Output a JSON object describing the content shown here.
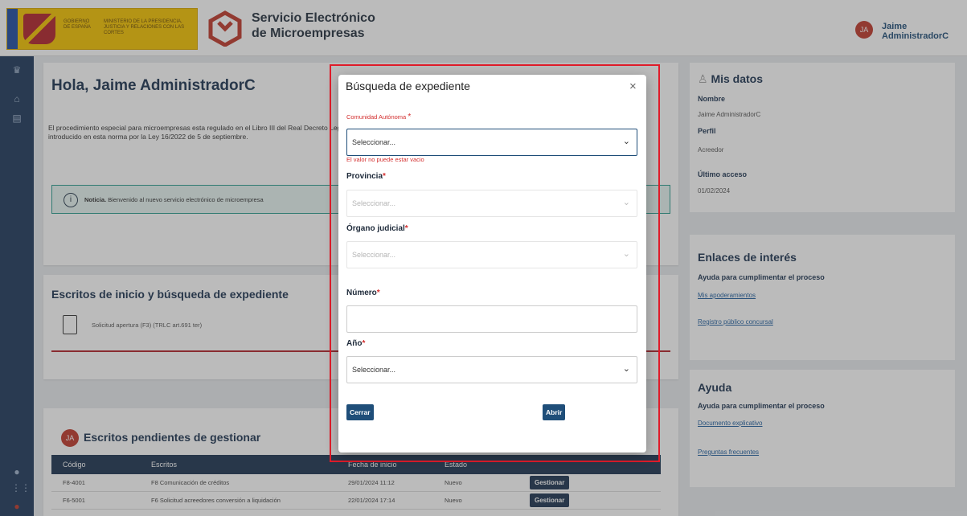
{
  "header": {
    "gov_line1": "GOBIERNO DE ESPAÑA",
    "gov_line2": "MINISTERIO DE LA PRESIDENCIA, JUSTICIA Y RELACIONES CON LAS CORTES",
    "app_title": "Servicio Electrónico de Microempresas",
    "user_initials": "JA",
    "user_name": "Jaime AdministradorC"
  },
  "main": {
    "greeting": "Hola, Jaime AdministradorC",
    "intro": "El procedimiento especial para microempresas esta regulado en el Libro III del Real Decreto Legislativo 1/2020, de 5 de mayo, por el que se aprueba el texto refundido de la Ley Concursal y ha sido introducido en esta norma por la Ley 16/2022 de 5 de septiembre.",
    "notice_label": "Noticia.",
    "notice_text": "Bienvenido al nuevo servicio electrónico de microempresa",
    "escritos_title": "Escritos de inicio y búsqueda de expediente",
    "escrito_item": "Solicitud apertura (F3) (TRLC art.691 ter)",
    "pendientes_title": "Escritos pendientes de gestionar",
    "table": {
      "headers": [
        "Código",
        "Escritos",
        "Fecha de inicio",
        "Estado"
      ],
      "rows": [
        [
          "F8-4001",
          "F8 Comunicación de créditos",
          "29/01/2024 11:12",
          "Nuevo",
          "Gestionar"
        ],
        [
          "F6-5001",
          "F6 Solicitud acreedores conversión a liquidación",
          "22/01/2024 17:14",
          "Nuevo",
          "Gestionar"
        ]
      ]
    }
  },
  "side": {
    "mis_datos": "Mis datos",
    "nombre_label": "Nombre",
    "nombre_val": "Jaime AdministradorC",
    "perfil_label": "Perfil",
    "perfil_val": "Acreedor",
    "acceso_label": "Último acceso",
    "acceso_val": "01/02/2024",
    "enlaces_title": "Enlaces de interés",
    "enlaces_sub": "Ayuda para cumplimentar el proceso",
    "link1": "Mis apoderamientos",
    "link2": "Registro público concursal",
    "ayuda_title": "Ayuda",
    "ayuda_sub": "Ayuda para cumplimentar el proceso",
    "link3": "Documento explicativo",
    "link4": "Preguntas frecuentes"
  },
  "modal": {
    "title": "Búsqueda de expediente",
    "close": "×",
    "comunidad_label": "Comunidad Autónoma",
    "comunidad_value": "Seleccionar...",
    "comunidad_error": "El valor no puede estar vacio",
    "provincia_label": "Provincia",
    "provincia_value": "Seleccionar...",
    "organo_label": "Órgano judicial",
    "organo_value": "Seleccionar...",
    "numero_label": "Número",
    "numero_value": "",
    "anio_label": "Año",
    "anio_value": "Seleccionar...",
    "cerrar": "Cerrar",
    "abrir": "Abrir",
    "required_mark": "*"
  },
  "colors": {
    "accent": "#1f4e79",
    "highlight_frame": "#e01c2a",
    "error": "#d32f2f"
  }
}
